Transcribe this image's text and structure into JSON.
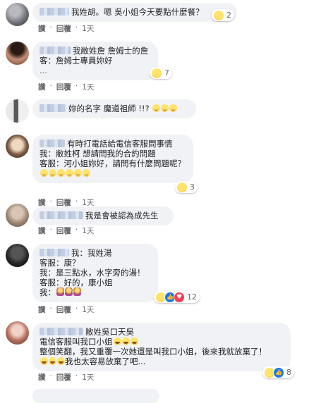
{
  "actions": {
    "like": "讚",
    "reply": "回覆",
    "dot": "·",
    "time": "1天"
  },
  "comments": [
    {
      "lines": [
        "我姓胡。嗯 吳小姐今天要點什麼餐？"
      ],
      "reaction_count": "2"
    },
    {
      "lines": [
        "我敝姓詹 詹姆士的詹",
        "客：詹姆士專員妳好",
        "..."
      ],
      "reaction_count": "7"
    },
    {
      "lines": [
        "妳的名字 魔道祖師 !!?"
      ]
    },
    {
      "lines": [
        "有時打電話給電信客服問事情",
        "我：敝姓柯 想請問我的合約問題",
        "客服：河小姐妳好，請問有什麼問題呢？"
      ],
      "reaction_count": "3"
    },
    {
      "lines": [
        "我是會被認為成先生"
      ]
    },
    {
      "lines": [
        "我：我姓湯",
        "客服：康？",
        "我：是三點水，水字旁的湯！",
        "客服：好的，康小姐",
        "我："
      ],
      "reaction_count": "12"
    },
    {
      "lines": [
        "敝姓吳口天吳",
        "電信客服叫我口小姐",
        "整個笑翻，我又重覆一次她還是叫我口小姐，後來我就放棄了！",
        "我也太容易放棄了吧..."
      ],
      "reaction_count": "8"
    }
  ],
  "icons": {
    "haha": "laughing-face-emoji",
    "like": "thumbs-up-icon",
    "love": "heart-icon"
  },
  "colors": {
    "bubble": "#f0f2f5",
    "secondary_text": "#65676b",
    "like_blue": "#1877f2",
    "love_red": "#f33e58"
  }
}
